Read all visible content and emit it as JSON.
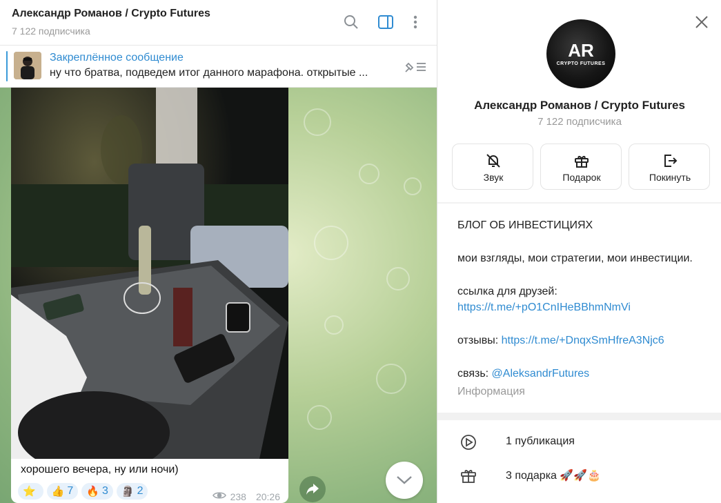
{
  "chat": {
    "title": "Александр Романов / Crypto Futures",
    "subscribers": "7 122 подписчика",
    "header_icons": [
      "search-icon",
      "sidebar-toggle-icon",
      "more-vertical-icon"
    ]
  },
  "pinned": {
    "title": "Закреплённое сообщение",
    "text": "ну что братва, подведем итог данного марафона.  открытые ..."
  },
  "message": {
    "caption": "хорошего вечера, ну или ночи)",
    "reactions": [
      {
        "emoji": "⭐",
        "count": ""
      },
      {
        "emoji": "👍",
        "count": "7"
      },
      {
        "emoji": "🔥",
        "count": "3"
      },
      {
        "emoji": "🗿",
        "count": "2"
      }
    ],
    "views": "238",
    "time": "20:26"
  },
  "info": {
    "avatar_text": "AR",
    "avatar_subtext": "CRYPTO FUTURES",
    "name": "Александр Романов / Crypto Futures",
    "subscribers": "7 122 подписчика",
    "actions": [
      {
        "label": "Звук",
        "icon": "bell-off-icon"
      },
      {
        "label": "Подарок",
        "icon": "gift-icon"
      },
      {
        "label": "Покинуть",
        "icon": "leave-icon"
      }
    ],
    "description": {
      "heading": "БЛОГ ОБ ИНВЕСТИЦИЯХ",
      "line1": "мои взгляды, мои стратегии, мои инвестиции.",
      "friends_label": "ссылка для друзей:",
      "friends_link": "https://t.me/+pO1CnIHeBBhmNmVi",
      "reviews_label": "отзывы: ",
      "reviews_link": "https://t.me/+DnqxSmHfreA3Njc6",
      "contact_label": "связь: ",
      "contact_link": "@AleksandrFutures",
      "section_label": "Информация"
    },
    "list": [
      {
        "text": "1 публикация",
        "icon": "play-circle-icon"
      },
      {
        "text": "3 подарка 🚀🚀🎂",
        "icon": "gift-icon"
      }
    ]
  },
  "colors": {
    "accent": "#2f8bd1",
    "chat_bg": "#b6cf97"
  }
}
